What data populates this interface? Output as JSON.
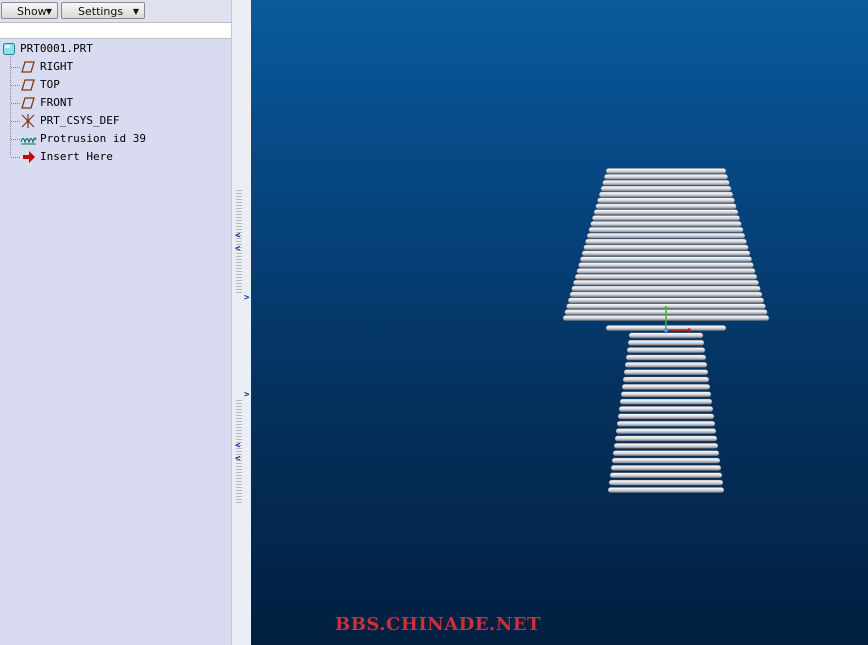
{
  "toolbar": {
    "show_label": "Show",
    "settings_label": "Settings"
  },
  "tree": {
    "root": "PRT0001.PRT",
    "items": [
      {
        "label": "RIGHT",
        "icon": "datum-plane-icon"
      },
      {
        "label": "TOP",
        "icon": "datum-plane-icon"
      },
      {
        "label": "FRONT",
        "icon": "datum-plane-icon"
      },
      {
        "label": "PRT_CSYS_DEF",
        "icon": "coordinate-system-icon"
      },
      {
        "label": "Protrusion id 39",
        "icon": "helical-sweep-icon"
      },
      {
        "label": "Insert Here",
        "icon": "insert-arrow-icon"
      }
    ]
  },
  "viewport": {
    "watermark": "BBS.CHINADE.NET"
  },
  "colors": {
    "tree_bg": "#d9dbf0",
    "viewport_top": "#0a5a9c",
    "viewport_bottom": "#021f40",
    "insert_arrow": "#cc0000"
  }
}
